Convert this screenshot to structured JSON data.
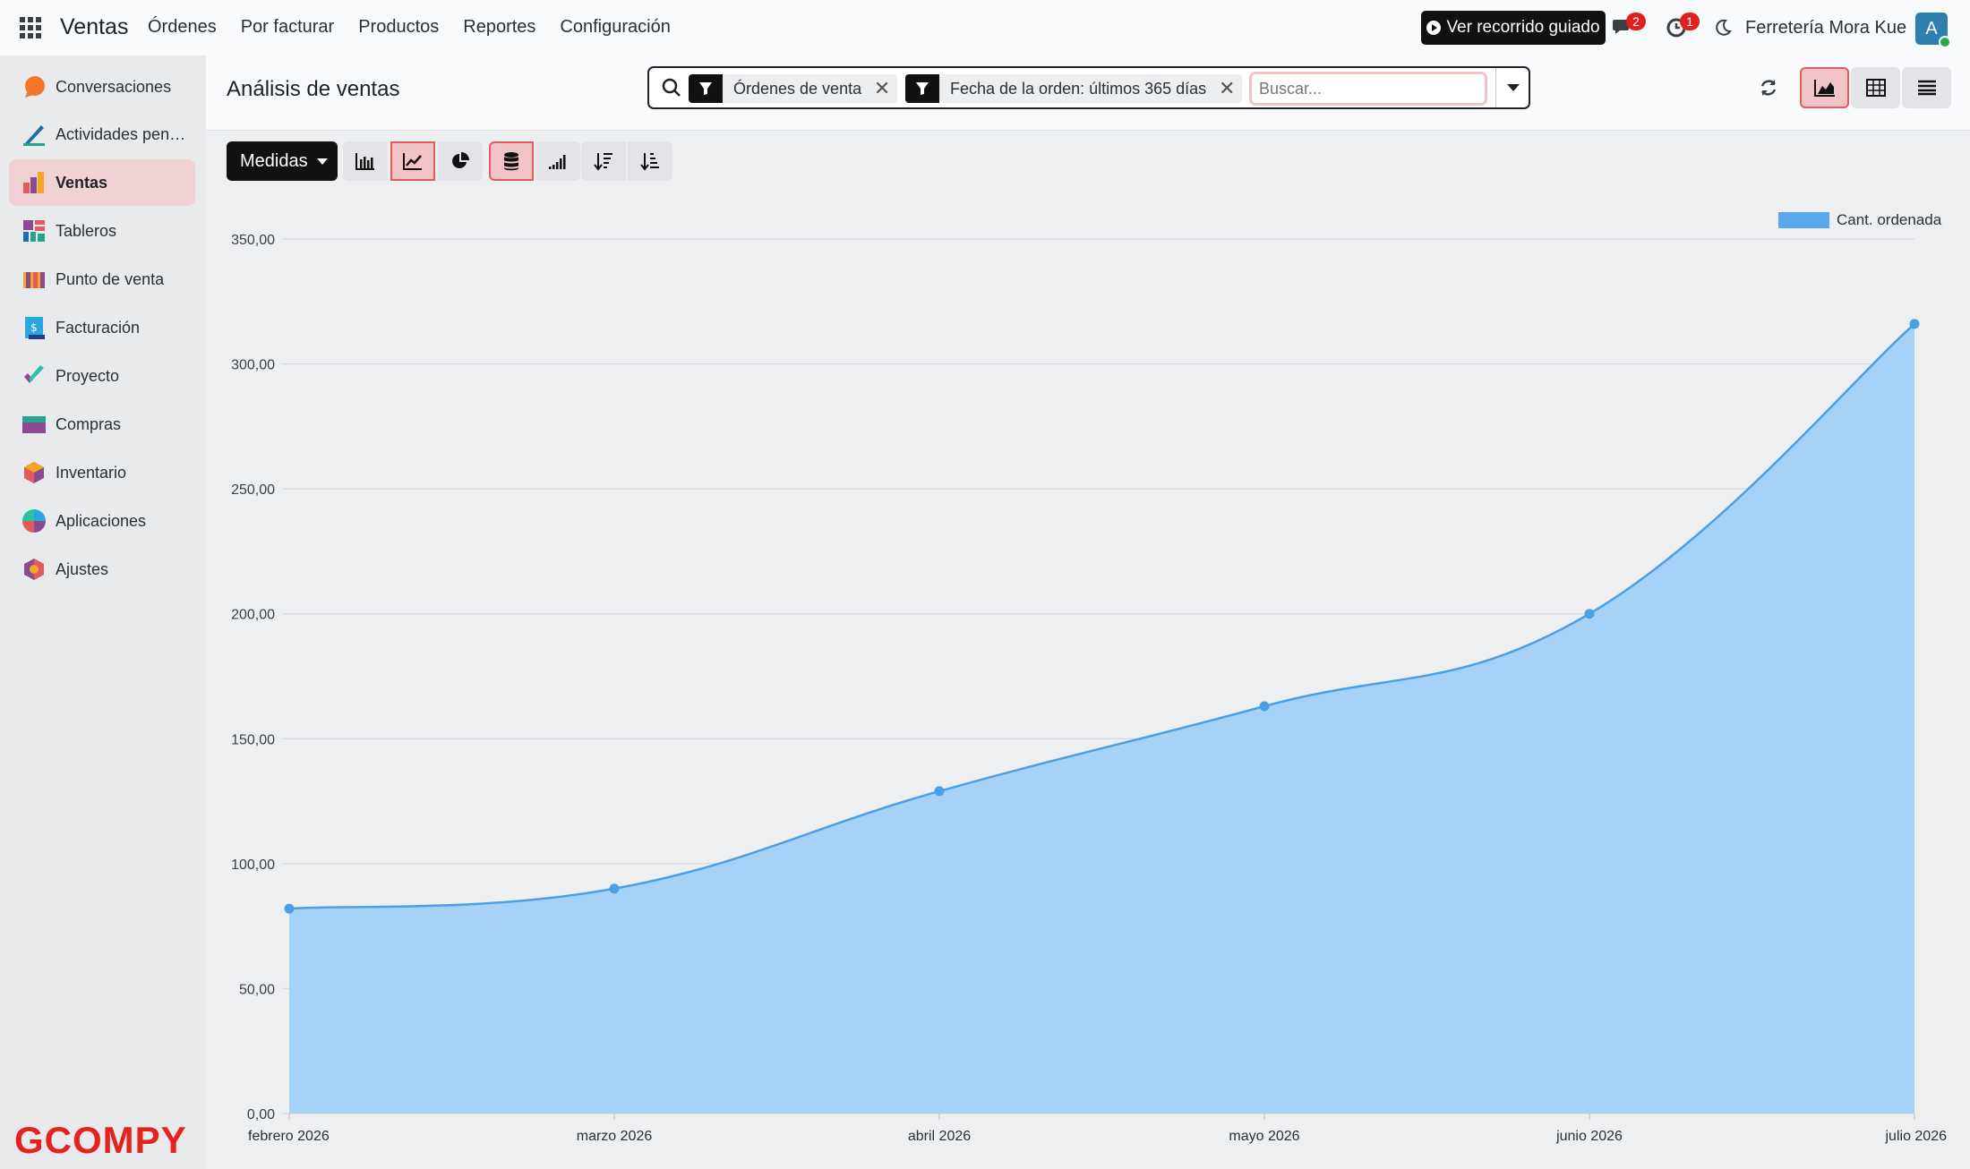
{
  "topbar": {
    "brand": "Ventas",
    "menu": [
      "Órdenes",
      "Por facturar",
      "Productos",
      "Reportes",
      "Configuración"
    ],
    "tour_button": "Ver recorrido guiado",
    "messages_count": "2",
    "activities_count": "1",
    "company": "Ferretería Mora Kue",
    "avatar_letter": "A"
  },
  "sidebar": {
    "items": [
      {
        "label": "Conversaciones",
        "icon": "chat-bubble-icon"
      },
      {
        "label": "Actividades pendientes",
        "icon": "pen-icon"
      },
      {
        "label": "Ventas",
        "icon": "sales-chart-icon",
        "active": true
      },
      {
        "label": "Tableros",
        "icon": "dashboard-icon"
      },
      {
        "label": "Punto de venta",
        "icon": "store-icon"
      },
      {
        "label": "Facturación",
        "icon": "invoice-icon"
      },
      {
        "label": "Proyecto",
        "icon": "project-check-icon"
      },
      {
        "label": "Compras",
        "icon": "card-icon"
      },
      {
        "label": "Inventario",
        "icon": "box-icon"
      },
      {
        "label": "Aplicaciones",
        "icon": "apps-pie-icon"
      },
      {
        "label": "Ajustes",
        "icon": "settings-hex-icon"
      }
    ],
    "logo_text": "GCOMPY"
  },
  "control_panel": {
    "title": "Análisis de ventas",
    "facets": [
      "Órdenes de venta",
      "Fecha de la orden: últimos 365 días"
    ],
    "search_placeholder": "Buscar..."
  },
  "toolbar": {
    "measures_label": "Medidas"
  },
  "colors": {
    "accent": "#e55a5f",
    "series_line": "#4a9fe6",
    "series_fill": "#a6d2f7"
  },
  "chart_data": {
    "type": "area",
    "categories": [
      "febrero 2026",
      "marzo 2026",
      "abril 2026",
      "mayo 2026",
      "junio 2026",
      "julio 2026"
    ],
    "series": [
      {
        "name": "Cant. ordenada",
        "values": [
          82,
          90,
          129,
          163,
          200,
          316
        ]
      }
    ],
    "ylim": [
      0,
      350
    ],
    "yticks": [
      "0,00",
      "50,00",
      "100,00",
      "150,00",
      "200,00",
      "250,00",
      "300,00",
      "350,00"
    ],
    "grid": true,
    "legend": "top-right"
  }
}
